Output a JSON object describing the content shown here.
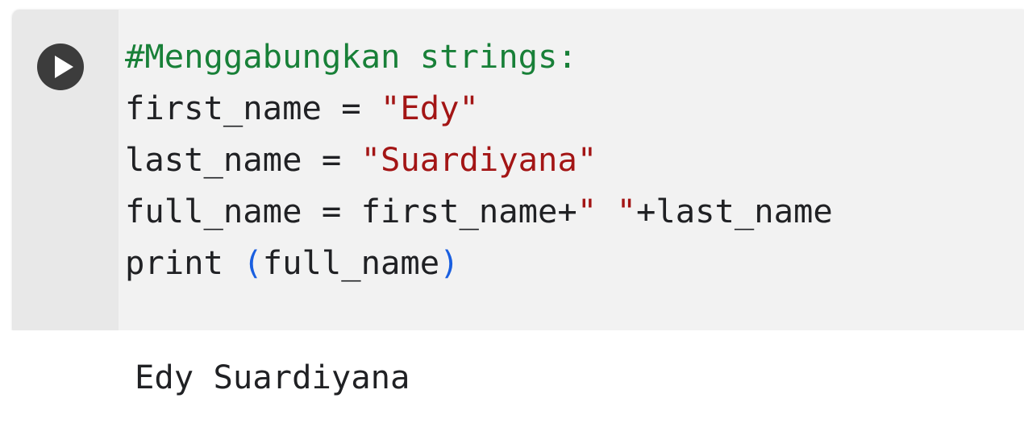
{
  "cell": {
    "run_icon": "play-icon",
    "code_lines": [
      [
        {
          "t": "#Menggabungkan strings:",
          "k": "comment"
        }
      ],
      [
        {
          "t": "first_name = ",
          "k": "plain"
        },
        {
          "t": "\"Edy\"",
          "k": "string"
        }
      ],
      [
        {
          "t": "last_name = ",
          "k": "plain"
        },
        {
          "t": "\"Suardiyana\"",
          "k": "string"
        }
      ],
      [
        {
          "t": "full_name = first_name+",
          "k": "plain"
        },
        {
          "t": "\" \"",
          "k": "string"
        },
        {
          "t": "+last_name",
          "k": "plain"
        }
      ],
      [
        {
          "t": "print ",
          "k": "plain"
        },
        {
          "t": "(",
          "k": "paren"
        },
        {
          "t": "full_name",
          "k": "plain"
        },
        {
          "t": ")",
          "k": "paren"
        }
      ]
    ],
    "output_text": "Edy Suardiyana"
  },
  "colors": {
    "comment": "#188038",
    "string": "#a31515",
    "paren": "#1a5fe0",
    "text": "#202124",
    "run_button": "#3c3c3c",
    "cell_bg": "#f2f2f2"
  }
}
